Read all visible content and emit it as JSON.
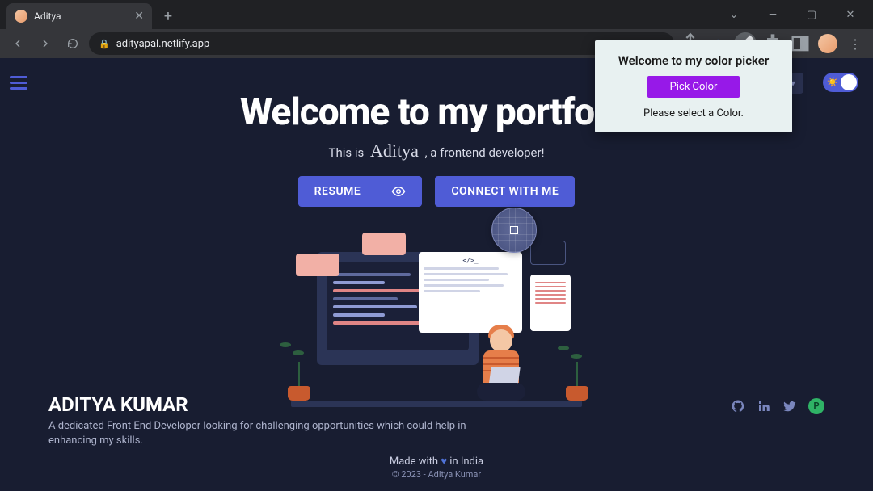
{
  "browser": {
    "tab_title": "Aditya",
    "url": "adityapal.netlify.app",
    "windowctrl": {
      "chevron": "⌄",
      "min": "—",
      "max": "▢",
      "close": "✕"
    }
  },
  "page": {
    "heading": "Welcome to my portfolio",
    "tagline_pre": "This is",
    "tagline_name": "Aditya",
    "tagline_post": ", a frontend developer!",
    "resume_label": "RESUME",
    "connect_label": "CONNECT WITH ME",
    "illust_code_tag": "</>_"
  },
  "footer": {
    "name": "ADITYA KUMAR",
    "bio": "A dedicated Front End Developer looking for challenging opportunities which could help in enhancing my skills.",
    "made_pre": "Made with",
    "made_post": "in India",
    "copyright": "© 2023 - Aditya Kumar",
    "p_label": "P"
  },
  "popup": {
    "title": "Welcome to my color picker",
    "button": "Pick Color",
    "message": "Please select a Color."
  }
}
